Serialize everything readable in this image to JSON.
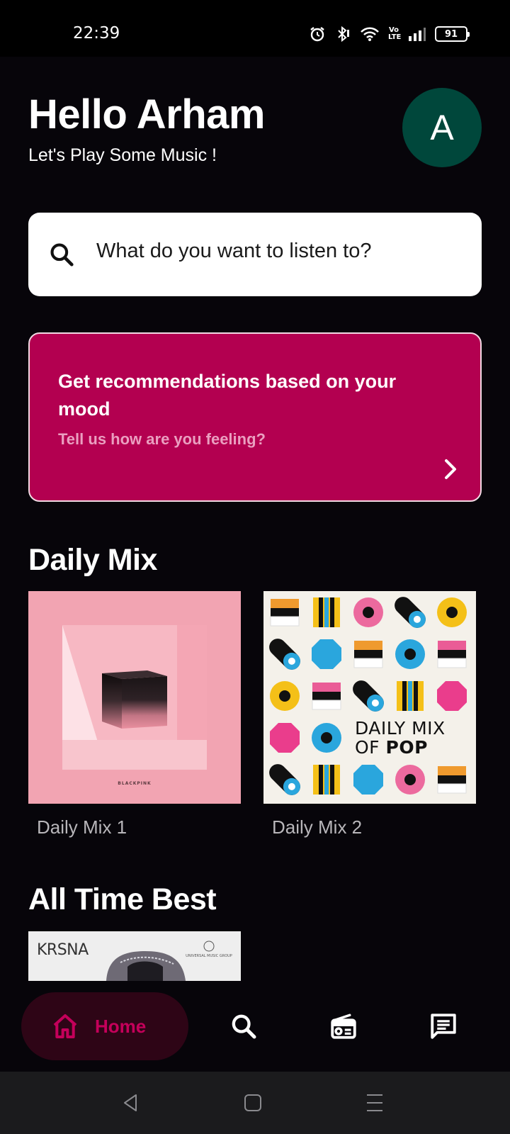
{
  "status_bar": {
    "time": "22:39",
    "lte": "Vo\nLTE",
    "battery": "91"
  },
  "header": {
    "greeting": "Hello Arham",
    "subtitle": "Let's Play Some Music !",
    "avatar_letter": "A",
    "avatar_color": "#00473b"
  },
  "search": {
    "placeholder": "What do you want to listen to?"
  },
  "mood_card": {
    "title": "Get recommendations based on your mood",
    "subtitle": "Tell us how are you feeling?",
    "color": "#b30050"
  },
  "daily_mix": {
    "title": "Daily Mix",
    "items": [
      {
        "label": "Daily Mix 1",
        "art_brand": "BLACKPINK"
      },
      {
        "label": "Daily Mix 2",
        "art_line1": "DAILY MIX",
        "art_line2a": "OF ",
        "art_line2b": "POP"
      }
    ]
  },
  "all_time_best": {
    "title": "All Time Best",
    "items": [
      {
        "art_text": "KRSNA",
        "art_logo": "UNIVERSAL MUSIC GROUP"
      }
    ]
  },
  "bottom_nav": {
    "items": [
      {
        "label": "Home",
        "icon": "home-icon",
        "active": true
      },
      {
        "label": "",
        "icon": "search-icon"
      },
      {
        "label": "",
        "icon": "radio-icon"
      },
      {
        "label": "",
        "icon": "chat-icon"
      }
    ],
    "active_color": "#c4005a"
  },
  "system_nav": {
    "icons": [
      "back-icon",
      "home-square-icon",
      "menu-icon"
    ]
  }
}
